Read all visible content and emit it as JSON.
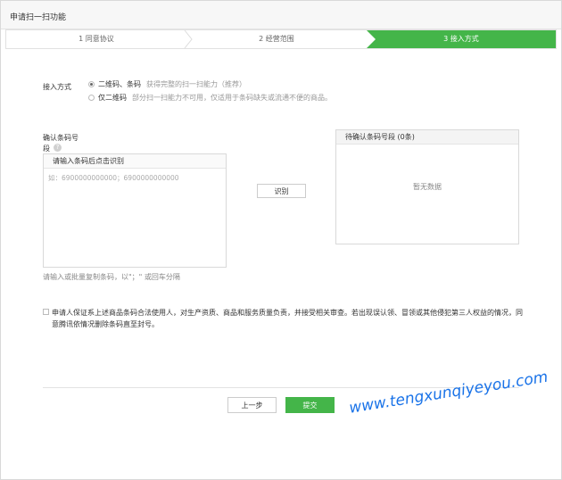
{
  "header": {
    "title": "申请扫一扫功能"
  },
  "steps": [
    {
      "label": "1 同意协议",
      "active": false
    },
    {
      "label": "2 经营范围",
      "active": false
    },
    {
      "label": "3 接入方式",
      "active": true
    }
  ],
  "access": {
    "label": "接入方式",
    "options": [
      {
        "label": "二维码、条码",
        "desc": "获得完整的扫一扫能力（推荐）",
        "selected": true
      },
      {
        "label": "仅二维码",
        "desc": "部分扫一扫能力不可用，仅适用于条码缺失或流通不便的商品。",
        "selected": false
      }
    ]
  },
  "confirm": {
    "label_line1": "确认条码号",
    "label_line2": "段",
    "help_glyph": "?",
    "input_header": "请输入条码后点击识别",
    "input_placeholder": "如：6900000000000；6900000000000",
    "identify_button": "识别",
    "hint": "请输入或批量复制条码，以\"；\" 或回车分隔"
  },
  "pending": {
    "header": "待确认条码号段 (0条)",
    "empty": "暂无数据"
  },
  "agreement": {
    "checked": false,
    "text": "申请人保证系上述商品条码合法使用人，对生产资质、商品和服务质量负责，并接受相关审查。若出现误认领、冒领或其他侵犯第三人权益的情况，同意腾讯依情况删除条码直至封号。"
  },
  "footer": {
    "prev_button": "上一步",
    "submit_button": "提交"
  },
  "watermark": "www.tengxunqiyeyou.com",
  "colors": {
    "accent": "#44b549",
    "watermark": "#1a73e8"
  }
}
